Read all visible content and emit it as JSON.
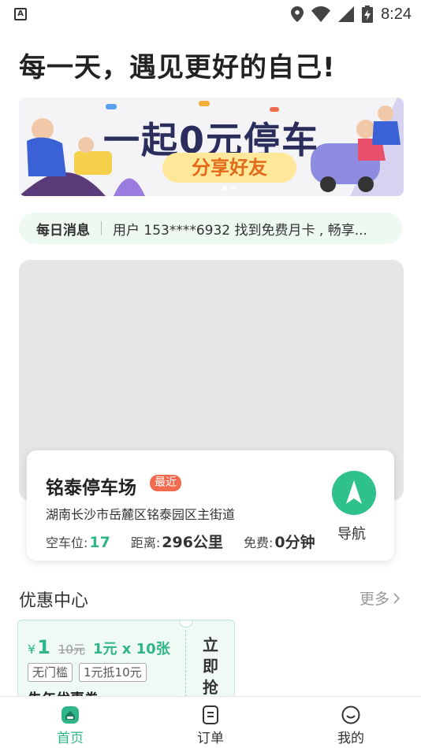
{
  "status_bar": {
    "left_icon_text": "A",
    "time": "8:24",
    "icons": [
      "location-icon",
      "wifi-icon",
      "signal-icon",
      "battery-charging-icon"
    ]
  },
  "headline": "每一天，遇见更好的自己!",
  "banner": {
    "title": "一起0元停车",
    "subtitle": "分享好友",
    "dots": 2,
    "active_dot": 0
  },
  "daily_message": {
    "label": "每日消息",
    "text": "用户 153****6932 找到免费月卡 , 畅享..."
  },
  "parking": {
    "name": "铭泰停车场",
    "badge": "最近",
    "address": "湖南长沙市岳麓区铭泰园区主街道",
    "spaces_label": "空车位:",
    "spaces_value": "17",
    "distance_label": "距离:",
    "distance_value": "296公里",
    "free_label": "免费:",
    "free_value": "0分钟",
    "nav_label": "导航"
  },
  "discount": {
    "title": "优惠中心",
    "more": "更多"
  },
  "coupon": {
    "yen": "¥",
    "price": "1",
    "old_price": "10元",
    "desc": "1元 x 10张",
    "tags": [
      "无门槛",
      "1元抵10元"
    ],
    "name": "失年优惠券",
    "grab": "立即抢"
  },
  "bottom_nav": {
    "tabs": [
      {
        "label": "首页",
        "icon": "home-icon",
        "active": true
      },
      {
        "label": "订单",
        "icon": "order-icon",
        "active": false
      },
      {
        "label": "我的",
        "icon": "profile-icon",
        "active": false
      }
    ]
  },
  "colors": {
    "accent": "#2fb58a",
    "badge": "#f26b4e",
    "map_bg": "#e6e6e6"
  }
}
